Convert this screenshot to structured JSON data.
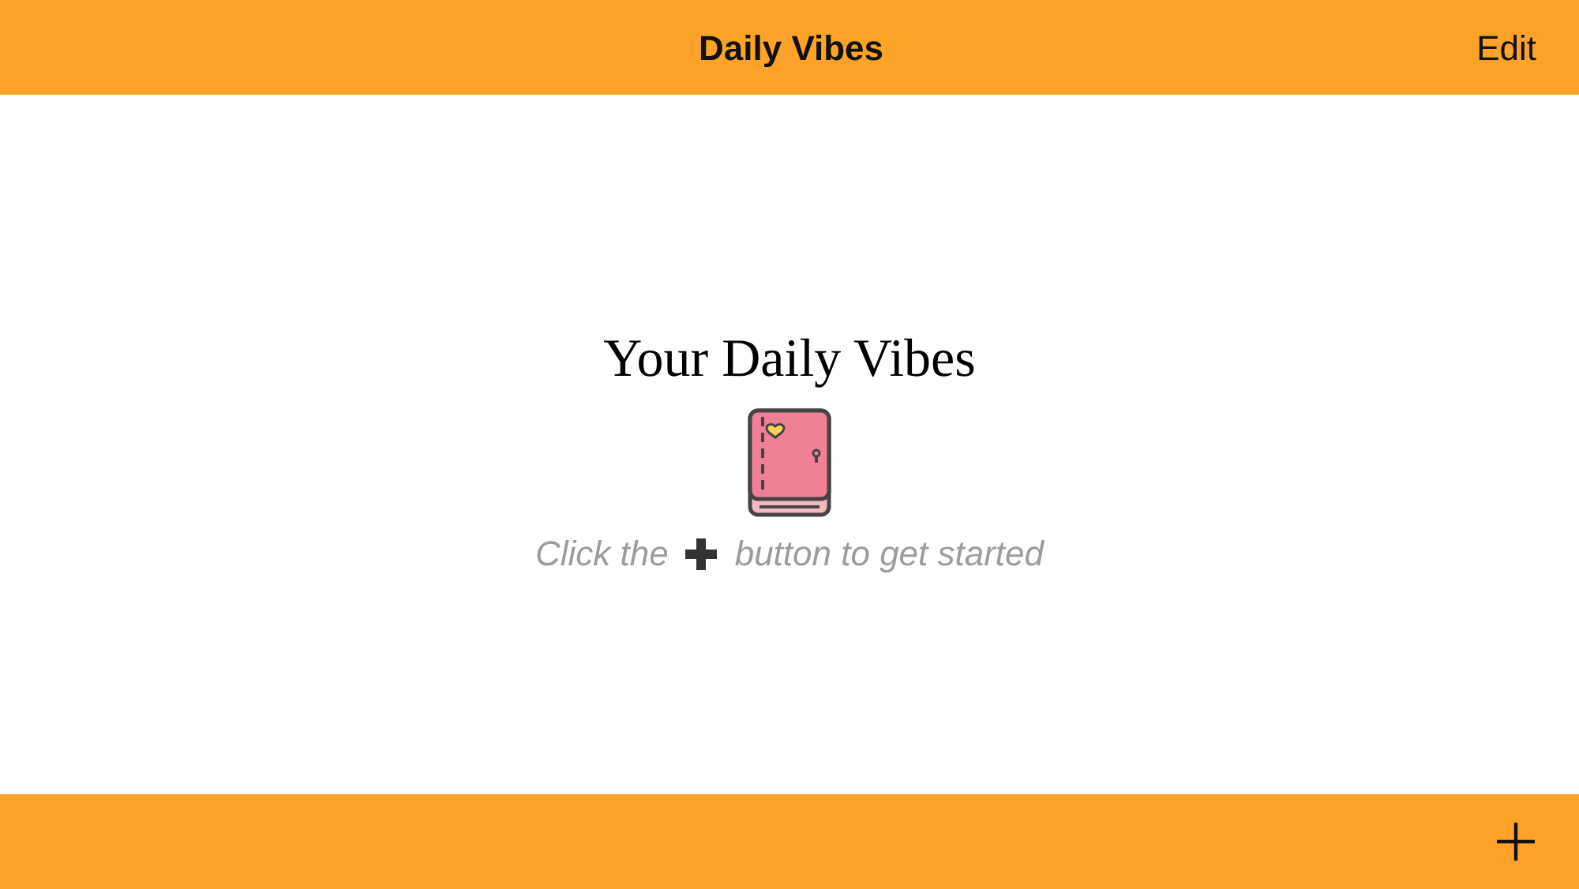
{
  "nav_bar": {
    "title": "Daily Vibes",
    "edit_button": "Edit"
  },
  "empty_state": {
    "heading": "Your Daily Vibes",
    "hint_before": "Click the",
    "hint_after": "button to get started"
  },
  "toolbar": {
    "add_button": true
  }
}
